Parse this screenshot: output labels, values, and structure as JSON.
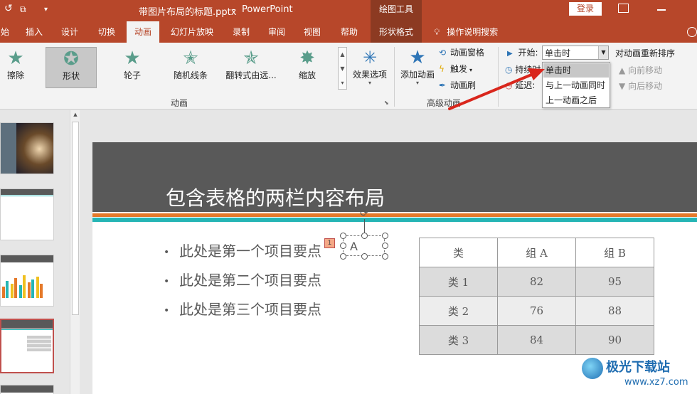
{
  "titlebar": {
    "doc_title": "带图片布局的标题.pptx",
    "separator": "-",
    "app_name": "PowerPoint",
    "tool_tab_group": "绘图工具",
    "login_label": "登录",
    "qa_undo": "↺",
    "qa_customize": "▾"
  },
  "tabs": {
    "start_partial": "始",
    "insert": "插入",
    "design": "设计",
    "transitions": "切换",
    "animations": "动画",
    "slideshow": "幻灯片放映",
    "record": "录制",
    "review": "审阅",
    "view": "视图",
    "help": "帮助",
    "shape_format": "形状格式",
    "tell_me": "操作说明搜索"
  },
  "ribbon": {
    "animation_gallery": [
      {
        "label": "擦除",
        "icon": "wipe-star-icon"
      },
      {
        "label": "形状",
        "icon": "shape-star-icon"
      },
      {
        "label": "轮子",
        "icon": "wheel-star-icon"
      },
      {
        "label": "随机线条",
        "icon": "random-bars-star-icon"
      },
      {
        "label": "翻转式由远...",
        "icon": "grow-turn-star-icon"
      },
      {
        "label": "缩放",
        "icon": "zoom-star-icon"
      }
    ],
    "effect_options": "效果选项",
    "animation_group_label": "动画",
    "add_animation": "添加动画",
    "animation_pane": "动画窗格",
    "trigger": "触发",
    "animation_painter": "动画刷",
    "advanced_group_label": "高级动画",
    "timing": {
      "start_label": "开始:",
      "start_value": "单击时",
      "duration_label": "持续时",
      "delay_label": "延迟:",
      "reorder_title": "对动画重新排序",
      "move_earlier": "向前移动",
      "move_later": "向后移动"
    },
    "start_options": [
      "单击时",
      "与上一动画同时",
      "上一动画之后"
    ]
  },
  "slide": {
    "title": "包含表格的两栏内容布局",
    "bullets": [
      "此处是第一个项目要点",
      "此处是第二个项目要点",
      "此处是第三个项目要点"
    ],
    "bullet_glyph": "•",
    "animation_marker": "1",
    "shape_text": "A",
    "table": {
      "headers": [
        "类",
        "组 A",
        "组 B"
      ],
      "rows": [
        [
          "类 1",
          "82",
          "95"
        ],
        [
          "类 2",
          "76",
          "88"
        ],
        [
          "类 3",
          "84",
          "90"
        ]
      ]
    }
  },
  "watermark": {
    "name": "极光下载站",
    "url": "www.xz7.com"
  },
  "colors": {
    "accent": "#b7472a",
    "header_gray": "#595959",
    "stripe_orange": "#e5792a",
    "stripe_teal": "#25b5b5",
    "highlight_arrow": "#d9261c"
  }
}
